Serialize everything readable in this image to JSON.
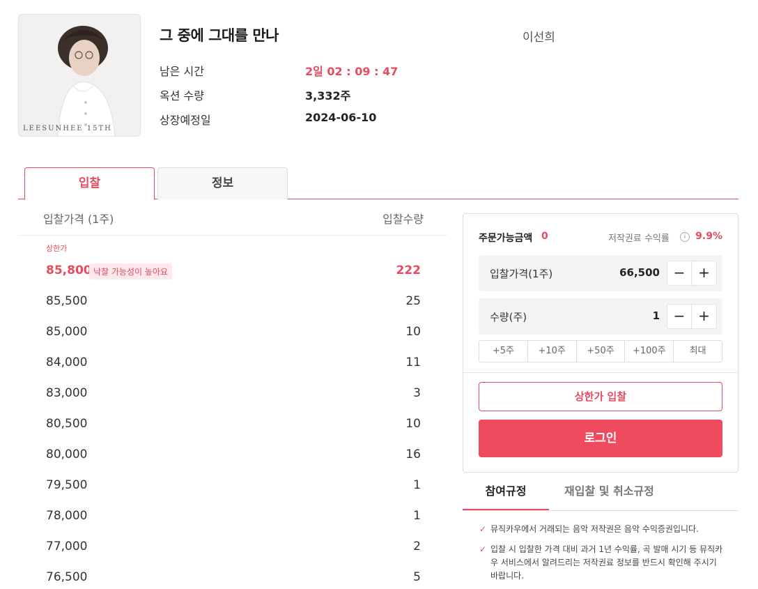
{
  "album": {
    "art_alt": "album-cover",
    "art_text": "LEESUNHEE 15TH",
    "title": "그 중에 그대를 만나",
    "artist": "이선희"
  },
  "meta": {
    "remaining_label": "남은 시간",
    "remaining_value": "2일 02 : 09 : 47",
    "quantity_label": "옥션 수량",
    "quantity_value": "3,332주",
    "listing_label": "상장예정일",
    "listing_value": "2024-06-10"
  },
  "tabs": {
    "bid": "입찰",
    "info": "정보"
  },
  "orderbook": {
    "price_header": "입찰가격 (1주)",
    "qty_header": "입찰수량",
    "ceiling_label": "상한가",
    "badge": "낙찰 가능성이 높아요",
    "rows": [
      {
        "price": "85,800",
        "qty": "222"
      },
      {
        "price": "85,500",
        "qty": "25"
      },
      {
        "price": "85,000",
        "qty": "10"
      },
      {
        "price": "84,000",
        "qty": "11"
      },
      {
        "price": "83,000",
        "qty": "3"
      },
      {
        "price": "80,500",
        "qty": "10"
      },
      {
        "price": "80,000",
        "qty": "16"
      },
      {
        "price": "79,500",
        "qty": "1"
      },
      {
        "price": "78,000",
        "qty": "1"
      },
      {
        "price": "77,000",
        "qty": "2"
      },
      {
        "price": "76,500",
        "qty": "5"
      }
    ]
  },
  "panel": {
    "available_label": "주문가능금액",
    "available_value": "0",
    "royalty_label": "저작권료 수익률",
    "royalty_value": "9.9%",
    "info_icon": "i",
    "price_label": "입찰가격(1주)",
    "price_value": "66,500",
    "qty_label": "수량(주)",
    "qty_value": "1",
    "minus": "−",
    "plus": "+",
    "quick": [
      "+5주",
      "+10주",
      "+50주",
      "+100주",
      "최대"
    ],
    "ceiling_button": "상한가 입찰",
    "login_button": "로그인"
  },
  "rules": {
    "tab_participation": "참여규정",
    "tab_rebid": "재입찰 및 취소규정",
    "check": "✓",
    "item1": "뮤직카우에서 거래되는 음악 저작권은 음악 수익증권입니다.",
    "item2": "입찰 시 입찰한 가격 대비 과거 1년 수익률, 곡 발매 시기 등 뮤직카우 서비스에서 알려드리는 저작권료 정보를 반드시 확인해 주시기 바랍니다."
  },
  "colors": {
    "accent": "#e84a5f",
    "login": "#ef4a5d"
  }
}
